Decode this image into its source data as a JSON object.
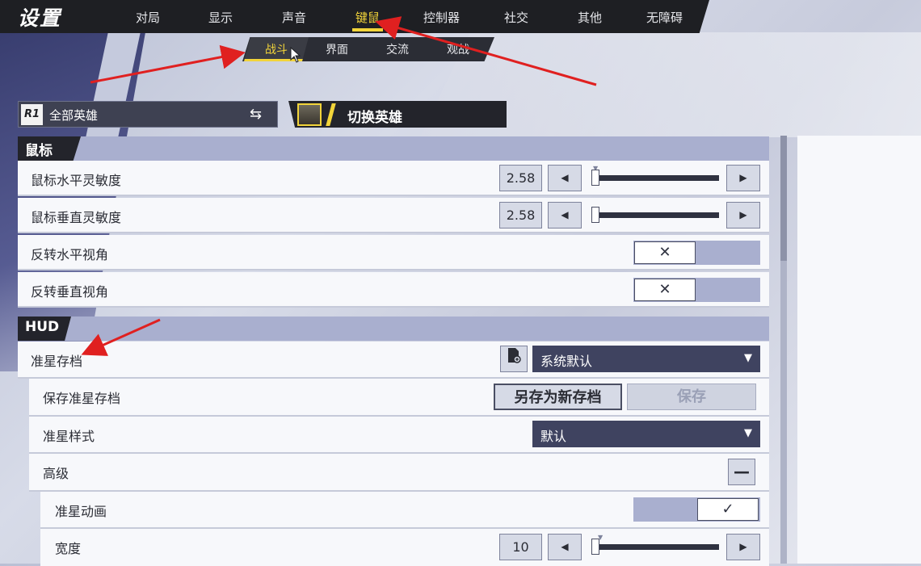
{
  "header": {
    "title": "设置",
    "tabs": [
      {
        "label": "对局",
        "active": false
      },
      {
        "label": "显示",
        "active": false
      },
      {
        "label": "声音",
        "active": false
      },
      {
        "label": "键鼠",
        "active": true
      },
      {
        "label": "控制器",
        "active": false
      },
      {
        "label": "社交",
        "active": false
      },
      {
        "label": "其他",
        "active": false
      },
      {
        "label": "无障碍",
        "active": false
      }
    ]
  },
  "subtabs": [
    {
      "label": "战斗",
      "active": true
    },
    {
      "label": "界面",
      "active": false
    },
    {
      "label": "交流",
      "active": false
    },
    {
      "label": "观战",
      "active": false
    }
  ],
  "hero": {
    "logo_text": "R1",
    "select_label": "全部英雄",
    "switch_label": "切换英雄"
  },
  "sections": {
    "mouse": {
      "title": "鼠标",
      "rows": {
        "h_sens": {
          "label": "鼠标水平灵敏度",
          "value": "2.58",
          "fraction": 0.02
        },
        "v_sens": {
          "label": "鼠标垂直灵敏度",
          "value": "2.58",
          "fraction": 0.02
        },
        "invert_h": {
          "label": "反转水平视角",
          "on": false
        },
        "invert_v": {
          "label": "反转垂直视角",
          "on": false
        }
      }
    },
    "hud": {
      "title": "HUD",
      "rows": {
        "crosshair_profile": {
          "label": "准星存档",
          "selected": "系统默认"
        },
        "save_profile": {
          "label": "保存准星存档",
          "save_as_label": "另存为新存档",
          "save_label": "保存"
        },
        "crosshair_style": {
          "label": "准星样式",
          "selected": "默认"
        },
        "advanced": {
          "label": "高级",
          "expanded": true
        },
        "crosshair_anim": {
          "label": "准星动画",
          "on": true
        },
        "width": {
          "label": "宽度",
          "value": "10",
          "fraction": 0.02
        }
      }
    }
  },
  "icons": {
    "swap": "⇆",
    "left_arrow": "◀",
    "right_arrow": "▶",
    "cross": "✕",
    "check": "✓",
    "caret": "▼",
    "minus": "—"
  },
  "colors": {
    "accent": "#f2d43a",
    "section_bar": "#a9afcf",
    "dark": "#1e1f23"
  }
}
